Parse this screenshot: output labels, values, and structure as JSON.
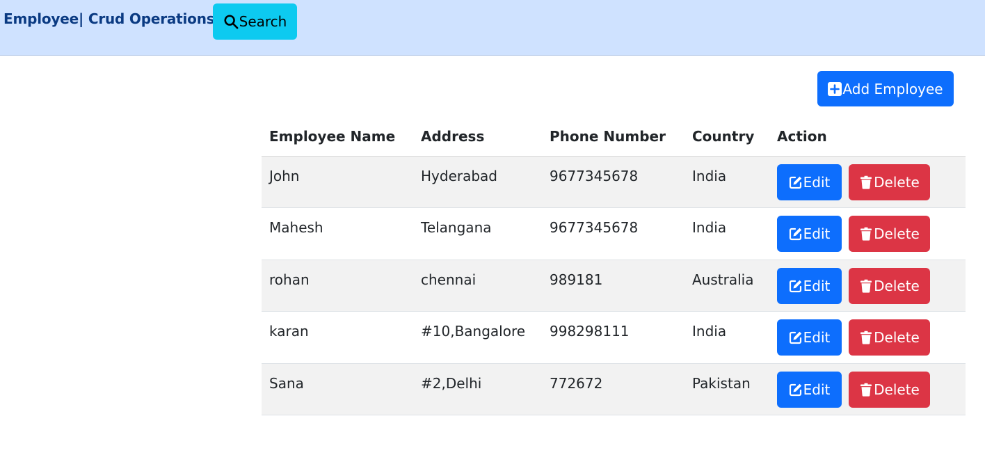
{
  "navbar": {
    "brand": "Employee| Crud Operations",
    "search_label": "Search"
  },
  "toolbar": {
    "add_label": "Add Employee"
  },
  "table": {
    "headers": [
      "Employee Name",
      "Address",
      "Phone Number",
      "Country",
      "Action"
    ],
    "rows": [
      {
        "name": "John",
        "address": "Hyderabad",
        "phone": "9677345678",
        "country": "India"
      },
      {
        "name": "Mahesh",
        "address": "Telangana",
        "phone": "9677345678",
        "country": "India"
      },
      {
        "name": "rohan",
        "address": "chennai",
        "phone": "989181",
        "country": "Australia"
      },
      {
        "name": "karan",
        "address": "#10,Bangalore",
        "phone": "998298111",
        "country": "India"
      },
      {
        "name": "Sana",
        "address": "#2,Delhi",
        "phone": "772672",
        "country": "Pakistan"
      }
    ],
    "edit_label": "Edit",
    "delete_label": "Delete"
  },
  "colors": {
    "navbar_bg": "#cfe2ff",
    "brand": "#0a3a82",
    "search_btn": "#0dcaf0",
    "primary": "#0d6efd",
    "danger": "#dc3545",
    "stripe": "#f2f2f2"
  },
  "icons": {
    "search": "search-icon",
    "add": "plus-square-icon",
    "edit": "pencil-square-icon",
    "delete": "trash-icon"
  }
}
